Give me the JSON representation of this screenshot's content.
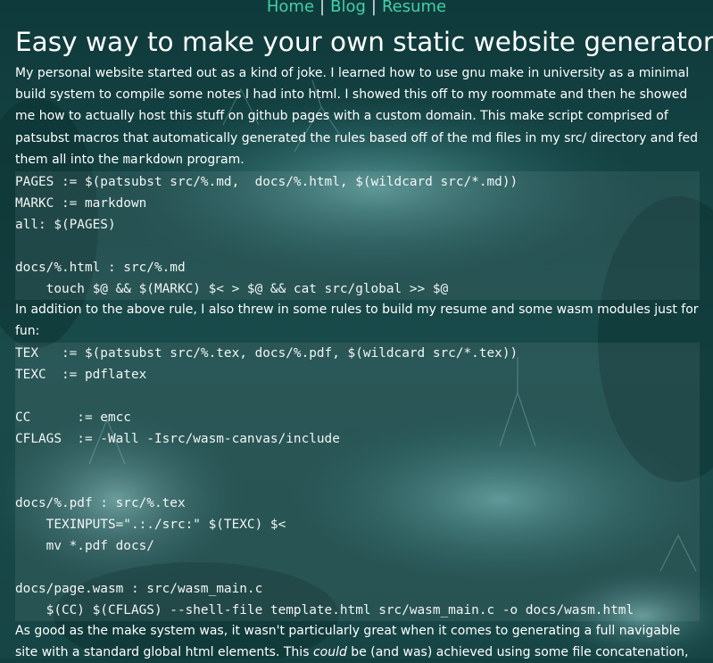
{
  "nav": {
    "links": [
      "Home",
      "Blog",
      "Resume"
    ],
    "separator": "|"
  },
  "title": "Easy way to make your own static website generator",
  "paragraphs": {
    "p1_before": "My personal website started out as a kind of joke. I learned how to use gnu make in university as a minimal build system to compile some notes I had into html. I showed this off to my roommate and then he showed me how to actually host this stuff on github pages with a custom domain. This make script comprised of patsubst macros that automatically generated the rules based off of the md files in my src/ directory and fed them all into the ",
    "p1_code": "markdown",
    "p1_after": " program.",
    "p2": "In addition to the above rule, I also threw in some rules to build my resume and some wasm modules just for fun:",
    "p3_before": "As good as the make system was, it wasn't particularly great when it comes to generating a full navigable site with a standard global html elements. This ",
    "p3_em": "could",
    "p3_after": " be (and was) achieved using some file concatenation,"
  },
  "code_blocks": {
    "block1": "PAGES := $(patsubst src/%.md,  docs/%.html, $(wildcard src/*.md))\nMARKC := markdown\nall: $(PAGES)\n\ndocs/%.html : src/%.md\n    touch $@ && $(MARKC) $< > $@ && cat src/global >> $@",
    "block2": "TEX   := $(patsubst src/%.tex, docs/%.pdf, $(wildcard src/*.tex))\nTEXC  := pdflatex\n\nCC      := emcc\nCFLAGS  := -Wall -Isrc/wasm-canvas/include\n\n\ndocs/%.pdf : src/%.tex\n    TEXINPUTS=\".:./src:\" $(TEXC) $<\n    mv *.pdf docs/\n\ndocs/page.wasm : src/wasm_main.c\n    $(CC) $(CFLAGS) --shell-file template.html src/wasm_main.c -o docs/wasm.html"
  },
  "colors": {
    "background": "#123f3f",
    "link": "#43d0a6",
    "text": "#ffffff"
  }
}
